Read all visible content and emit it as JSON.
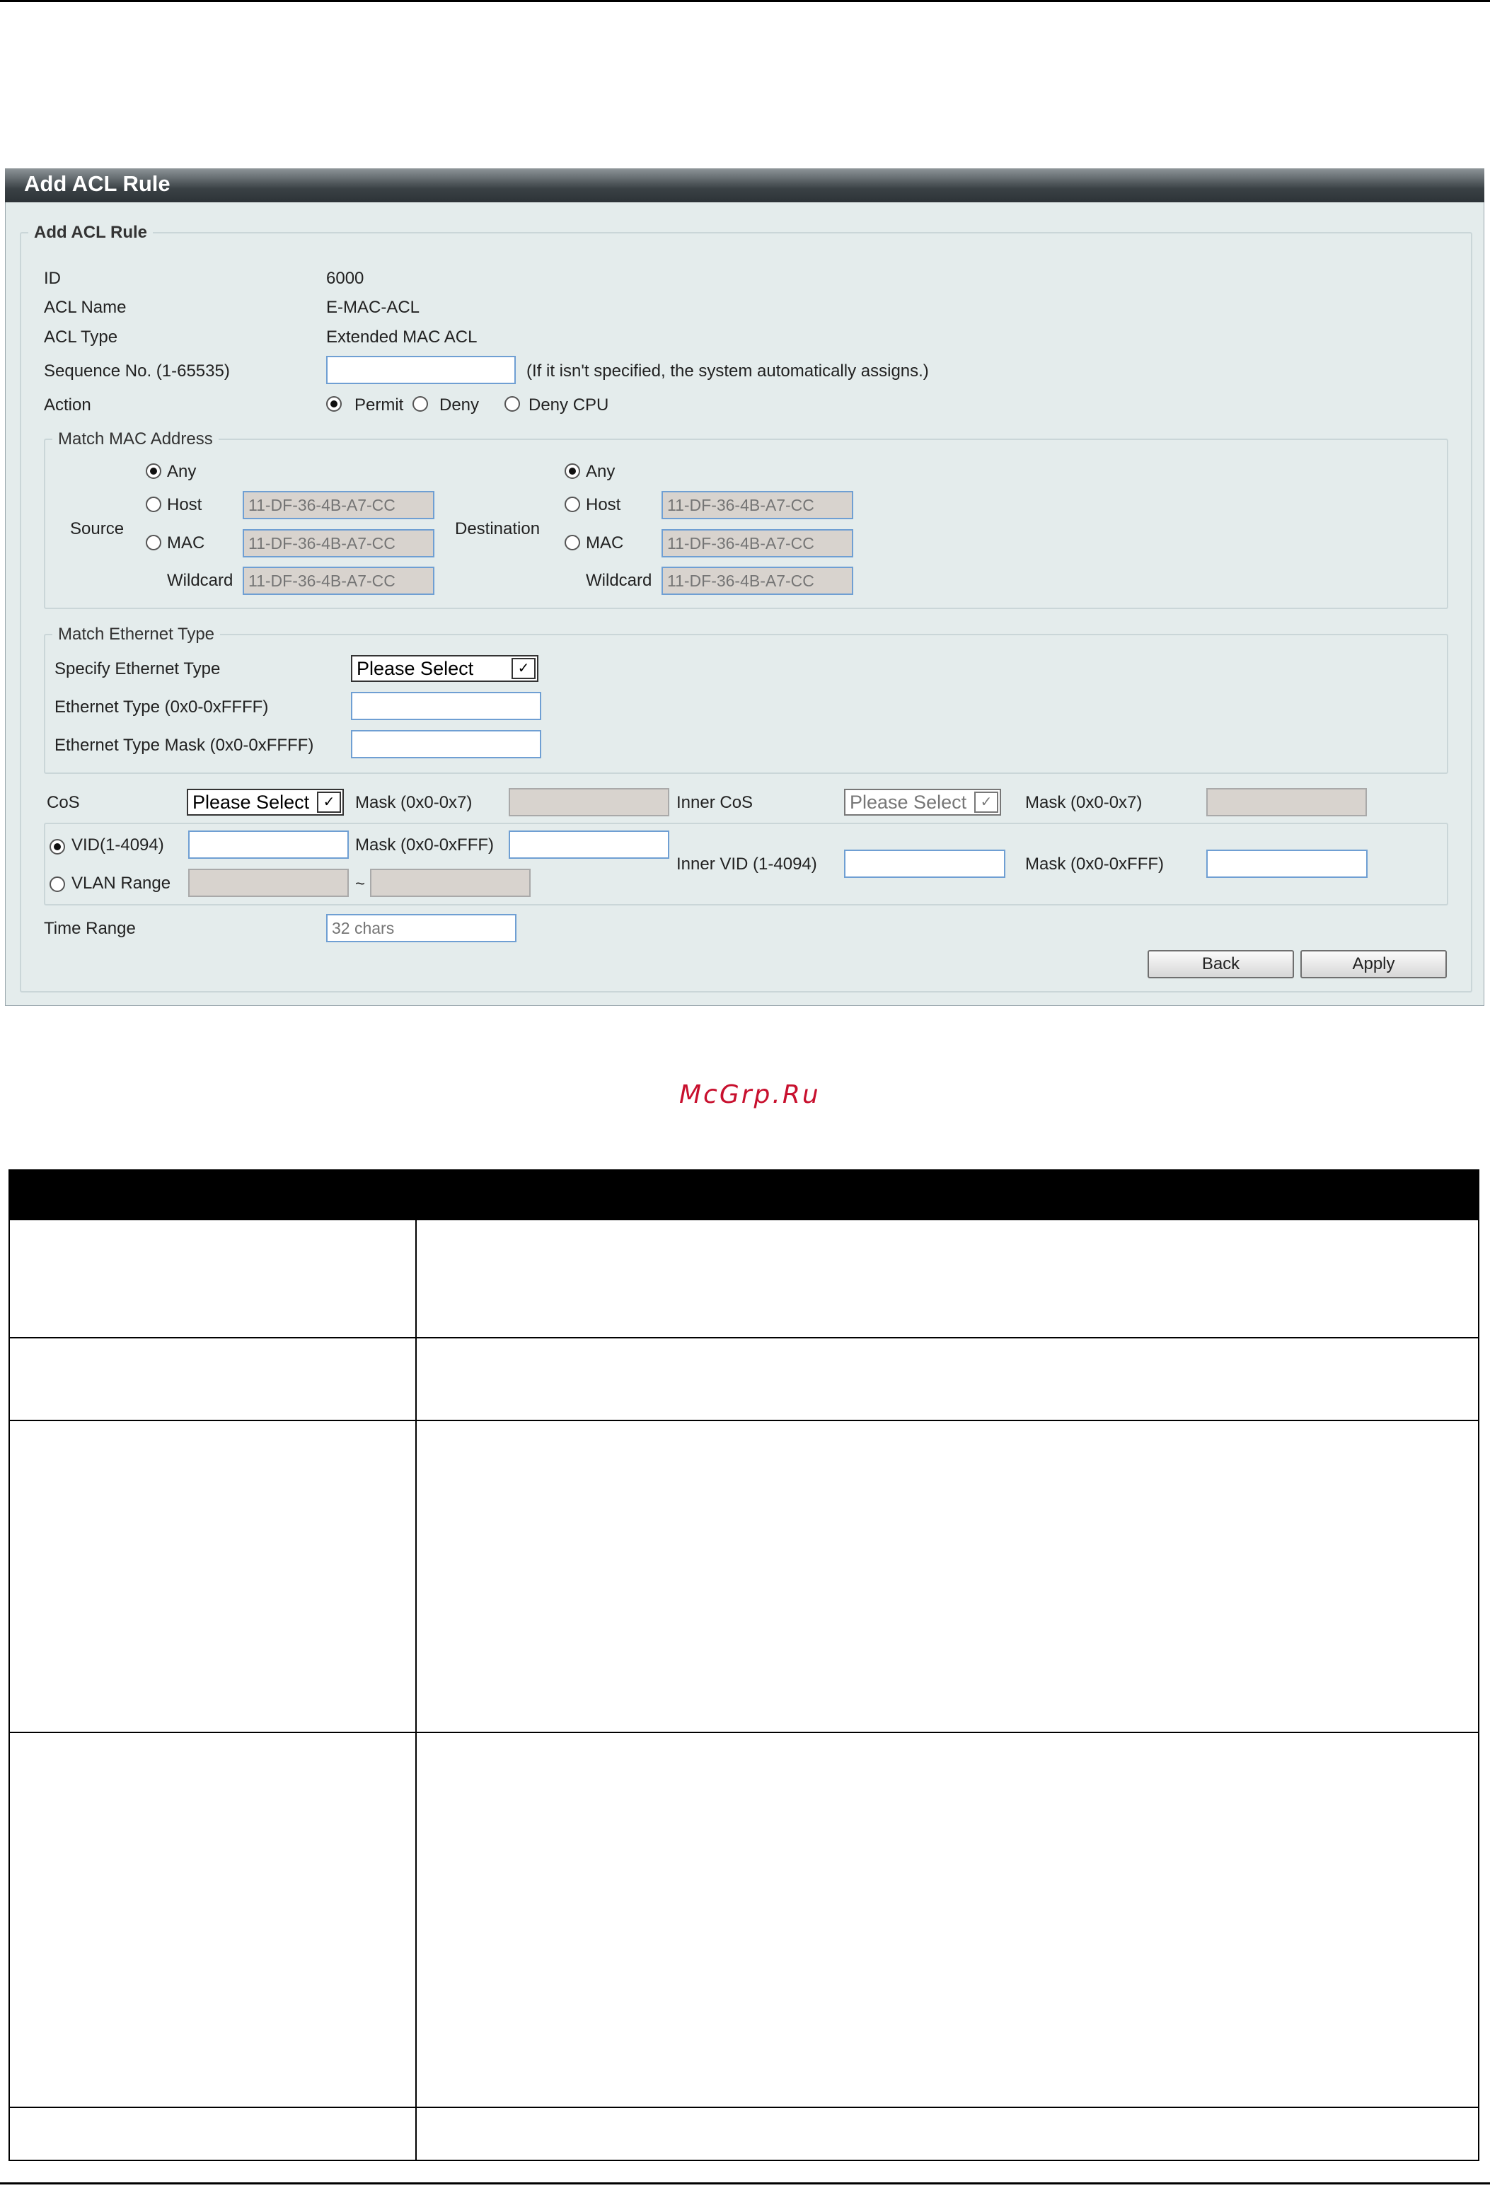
{
  "panel": {
    "title": "Add ACL Rule",
    "fieldset_title": "Add ACL Rule",
    "id_label": "ID",
    "id_value": "6000",
    "acl_name_label": "ACL Name",
    "acl_name_value": "E-MAC-ACL",
    "acl_type_label": "ACL Type",
    "acl_type_value": "Extended MAC ACL",
    "sequence_label": "Sequence No. (1-65535)",
    "sequence_value": "",
    "sequence_hint": "(If it isn't specified, the system automatically assigns.)",
    "action_label": "Action",
    "action_options": [
      "Permit",
      "Deny",
      "Deny CPU"
    ],
    "action_selected": "Permit"
  },
  "match_mac": {
    "legend": "Match MAC Address",
    "source_label": "Source",
    "destination_label": "Destination",
    "any_label": "Any",
    "host_label": "Host",
    "mac_label": "MAC",
    "wildcard_label": "Wildcard",
    "src_host_placeholder": "11-DF-36-4B-A7-CC",
    "src_mac_placeholder": "11-DF-36-4B-A7-CC",
    "src_wildcard_placeholder": "11-DF-36-4B-A7-CC",
    "dst_host_placeholder": "11-DF-36-4B-A7-CC",
    "dst_mac_placeholder": "11-DF-36-4B-A7-CC",
    "dst_wildcard_placeholder": "11-DF-36-4B-A7-CC",
    "source_selected": "Any",
    "destination_selected": "Any"
  },
  "match_eth": {
    "legend": "Match Ethernet Type",
    "specify_label": "Specify Ethernet Type",
    "specify_value": "Please Select",
    "type_label": "Ethernet Type (0x0-0xFFFF)",
    "type_value": "",
    "mask_label": "Ethernet Type Mask (0x0-0xFFFF)",
    "mask_value": ""
  },
  "cos": {
    "cos_label": "CoS",
    "cos_value": "Please Select",
    "cos_mask_label": "Mask (0x0-0x7)",
    "inner_cos_label": "Inner CoS",
    "inner_cos_value": "Please Select",
    "inner_cos_mask_label": "Mask (0x0-0x7)"
  },
  "vlan": {
    "vid_label": "VID(1-4094)",
    "vid_mask_label": "Mask (0x0-0xFFF)",
    "vlan_range_label": "VLAN Range",
    "range_separator": "~",
    "inner_vid_label": "Inner VID (1-4094)",
    "inner_vid_mask_label": "Mask (0x0-0xFFF)",
    "selected": "VID"
  },
  "time_range": {
    "label": "Time Range",
    "placeholder": "32 chars"
  },
  "buttons": {
    "back": "Back",
    "apply": "Apply"
  },
  "watermark": "McGrp.Ru"
}
